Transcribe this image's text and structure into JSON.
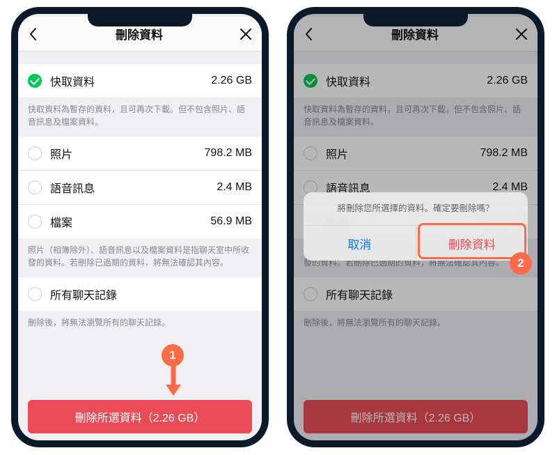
{
  "header": {
    "title": "刪除資料"
  },
  "items": {
    "cache": {
      "label": "快取資料",
      "value": "2.26 GB"
    },
    "photos": {
      "label": "照片",
      "value": "798.2 MB"
    },
    "voice": {
      "label": "語音訊息",
      "value": "2.4 MB"
    },
    "files": {
      "label": "檔案",
      "value": "56.9 MB"
    },
    "chats": {
      "label": "所有聊天記錄"
    }
  },
  "notes": {
    "cache": "快取資料為暫存的資料，且可再次下載。但不包含照片、語音訊息及檔案資料。",
    "files": "照片（相簿除外）、語音訊息以及檔案資料是指聊天室中所收發的資料。若刪除已過期的資料，將無法確認其內容。",
    "chats": "刪除後，將無法瀏覽所有的聊天記錄。"
  },
  "delete_button": "刪除所選資料（2.26 GB）",
  "sheet": {
    "message": "將刪除您所選擇的資料。確定要刪除嗎？",
    "cancel": "取消",
    "confirm": "刪除資料"
  },
  "annotations": {
    "step1": "1",
    "step2": "2"
  }
}
